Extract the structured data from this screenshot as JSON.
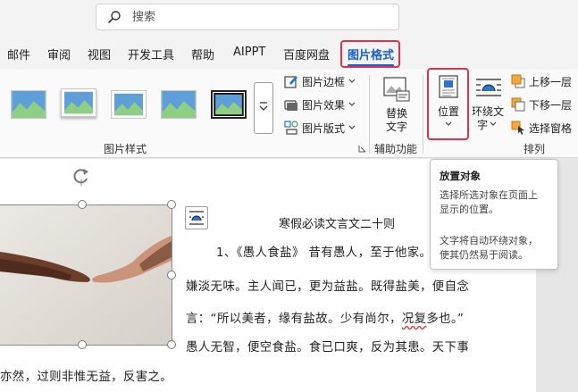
{
  "search": {
    "placeholder": "搜索"
  },
  "tabs": [
    {
      "label": "邮件"
    },
    {
      "label": "审阅"
    },
    {
      "label": "视图"
    },
    {
      "label": "开发工具"
    },
    {
      "label": "帮助"
    },
    {
      "label": "AIPPT"
    },
    {
      "label": "百度网盘"
    },
    {
      "label": "图片格式",
      "active": true
    }
  ],
  "ribbon": {
    "picture_styles": {
      "title": "图片样式",
      "border_label": "图片边框",
      "effects_label": "图片效果",
      "layout_label": "图片版式"
    },
    "accessibility": {
      "title": "辅助功能",
      "alt_text_line1": "替换",
      "alt_text_line2": "文字"
    },
    "arrange": {
      "title": "排列",
      "position_label": "位置",
      "wrap_line1": "环绕文",
      "wrap_line2": "字",
      "bring_forward": "上移一层",
      "send_backward": "下移一层",
      "selection_pane": "选择窗格"
    }
  },
  "tooltip": {
    "title": "放置对象",
    "desc_line1": "选择所选对象在页面上",
    "desc_line2": "显示的位置。",
    "desc_line3": "文字将自动环绕对象，",
    "desc_line4": "使其仍然易于阅读。"
  },
  "document": {
    "title": "寒假必读文言文二十则",
    "line1": "1、《愚人食盐》 昔有愚人，至于他家。",
    "line2": "嫌淡无味。主人闻已，更为益盐。既得盐美，便自念",
    "line3_a": "言：“所以美者，缘有盐故。少有尚尔，",
    "line3_squiggle": "况复",
    "line3_b": "多也。”",
    "line4": "愚人无智，便空食盐。食已口爽，反为其患。天下事",
    "line5": "亦然，过则非惟无益，反害之。"
  },
  "colors": {
    "accent": "#1a5ecc",
    "highlight": "#e0334b"
  }
}
